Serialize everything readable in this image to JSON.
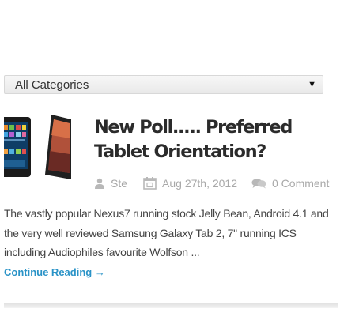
{
  "filter": {
    "selected": "All Categories",
    "arrow": "▼"
  },
  "post": {
    "title": "New Poll..... Preferred Tablet Orientation?",
    "author": "Ste",
    "date": "Aug 27th, 2012",
    "comments": "0 Comment",
    "excerpt": "The vastly popular Nexus7 running stock Jelly Bean, Android 4.1 and the very well reviewed Samsung Galaxy Tab 2, 7\" running ICS  including Audiophiles favourite Wolfson ...",
    "read_more": "Continue Reading →"
  },
  "icons": {
    "author": "person-icon",
    "date": "calendar-icon",
    "comments": "speech-bubbles-icon",
    "dropdown": "caret-down-icon"
  },
  "colors": {
    "link": "#2a93c7",
    "meta": "#a8a8a8",
    "title": "#2b2b2b"
  }
}
